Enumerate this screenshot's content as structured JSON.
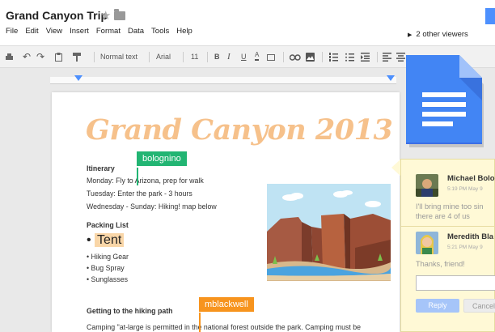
{
  "header": {
    "title": "Grand Canyon Trip",
    "menu": [
      "File",
      "Edit",
      "View",
      "Insert",
      "Format",
      "Data",
      "Tools",
      "Help"
    ],
    "viewers": "2 other viewers"
  },
  "toolbar": {
    "style": "Normal text",
    "font": "Arial",
    "size": "11"
  },
  "document": {
    "title": "Grand Canyon 2013",
    "itinerary_heading": "Itinerary",
    "itinerary": [
      "Monday: Fly to Arizona, prep for walk",
      "Tuesday: Enter the park - 3 hours",
      "Wednesday - Sunday: Hiking!  map below"
    ],
    "packing_heading": "Packing List",
    "packing_main": "Tent",
    "packing_items": [
      "Hiking Gear",
      "Bug Spray",
      "Sunglasses"
    ],
    "hiking_heading": "Getting to the hiking path",
    "hiking_text": "Camping \"at-large is permitted in the national forest outside the park. Camping must be"
  },
  "collaborators": {
    "user1": "bolognino",
    "user2": "mblackwell"
  },
  "comments": {
    "c1_name": "Michael Bolo",
    "c1_time": "5:19 PM May 9",
    "c1_line1": "I'll bring mine too sin",
    "c1_line2": "there are 4 of us",
    "c2_name": "Meredith Bla",
    "c2_time": "5:21 PM May 9",
    "c2_text": "Thanks, friend!",
    "reply_label": "Reply",
    "cancel_label": "Cancel"
  },
  "colors": {
    "accent": "#4d90fe",
    "title_orange": "#f6c18b",
    "cursor_green": "#22b573",
    "cursor_orange": "#f7941e"
  }
}
